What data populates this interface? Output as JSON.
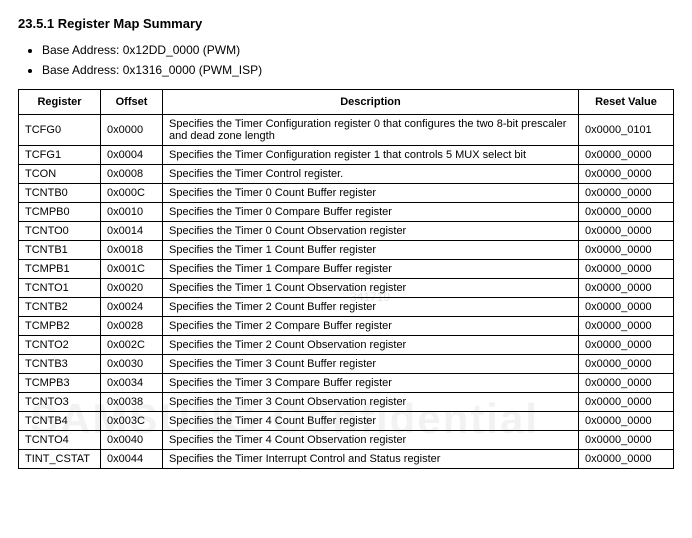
{
  "heading": "23.5.1 Register Map Summary",
  "addresses": [
    "Base Address: 0x12DD_0000 (PWM)",
    "Base Address: 0x1316_0000 (PWM_ISP)"
  ],
  "columns": {
    "register": "Register",
    "offset": "Offset",
    "description": "Description",
    "reset": "Reset Value"
  },
  "rows": [
    {
      "reg": "TCFG0",
      "off": "0x0000",
      "desc": "Specifies the Timer Configuration register 0 that configures the two 8-bit prescaler and dead zone length",
      "rst": "0x0000_0101"
    },
    {
      "reg": "TCFG1",
      "off": "0x0004",
      "desc": "Specifies the Timer Configuration    register 1 that controls 5 MUX select bit",
      "rst": "0x0000_0000"
    },
    {
      "reg": "TCON",
      "off": "0x0008",
      "desc": "Specifies the Timer Control register.",
      "rst": "0x0000_0000"
    },
    {
      "reg": "TCNTB0",
      "off": "0x000C",
      "desc": "Specifies the Timer 0 Count Buffer register",
      "rst": "0x0000_0000"
    },
    {
      "reg": "TCMPB0",
      "off": "0x0010",
      "desc": "Specifies the Timer 0 Compare Buffer register",
      "rst": "0x0000_0000"
    },
    {
      "reg": "TCNTO0",
      "off": "0x0014",
      "desc": "Specifies the Timer 0 Count Observation register",
      "rst": "0x0000_0000"
    },
    {
      "reg": "TCNTB1",
      "off": "0x0018",
      "desc": "Specifies the Timer 1 Count Buffer register",
      "rst": "0x0000_0000"
    },
    {
      "reg": "TCMPB1",
      "off": "0x001C",
      "desc": "Specifies the Timer 1 Compare Buffer register",
      "rst": "0x0000_0000"
    },
    {
      "reg": "TCNTO1",
      "off": "0x0020",
      "desc": "Specifies the Timer 1 Count Observation register",
      "rst": "0x0000_0000"
    },
    {
      "reg": "TCNTB2",
      "off": "0x0024",
      "desc": "Specifies the Timer 2 Count Buffer register",
      "rst": "0x0000_0000"
    },
    {
      "reg": "TCMPB2",
      "off": "0x0028",
      "desc": "Specifies the Timer 2 Compare Buffer register",
      "rst": "0x0000_0000"
    },
    {
      "reg": "TCNTO2",
      "off": "0x002C",
      "desc": "Specifies the Timer 2 Count Observation register",
      "rst": "0x0000_0000"
    },
    {
      "reg": "TCNTB3",
      "off": "0x0030",
      "desc": "Specifies the Timer 3 Count Buffer register",
      "rst": "0x0000_0000"
    },
    {
      "reg": "TCMPB3",
      "off": "0x0034",
      "desc": "Specifies the Timer 3 Compare Buffer register",
      "rst": "0x0000_0000"
    },
    {
      "reg": "TCNTO3",
      "off": "0x0038",
      "desc": "Specifies the Timer 3 Count Observation register",
      "rst": "0x0000_0000"
    },
    {
      "reg": "TCNTB4",
      "off": "0x003C",
      "desc": "Specifies the Timer 4 Count Buffer register",
      "rst": "0x0000_0000"
    },
    {
      "reg": "TCNTO4",
      "off": "0x0040",
      "desc": "Specifies the Timer 4 Count Observation register",
      "rst": "0x0000_0000"
    },
    {
      "reg": "TINT_CSTAT",
      "off": "0x0044",
      "desc": "Specifies the Timer Interrupt Control and Status register",
      "rst": "0x0000_0000"
    }
  ],
  "watermarks": {
    "wm1": "341719",
    "wm2": "SAMSUNG Confidential"
  }
}
